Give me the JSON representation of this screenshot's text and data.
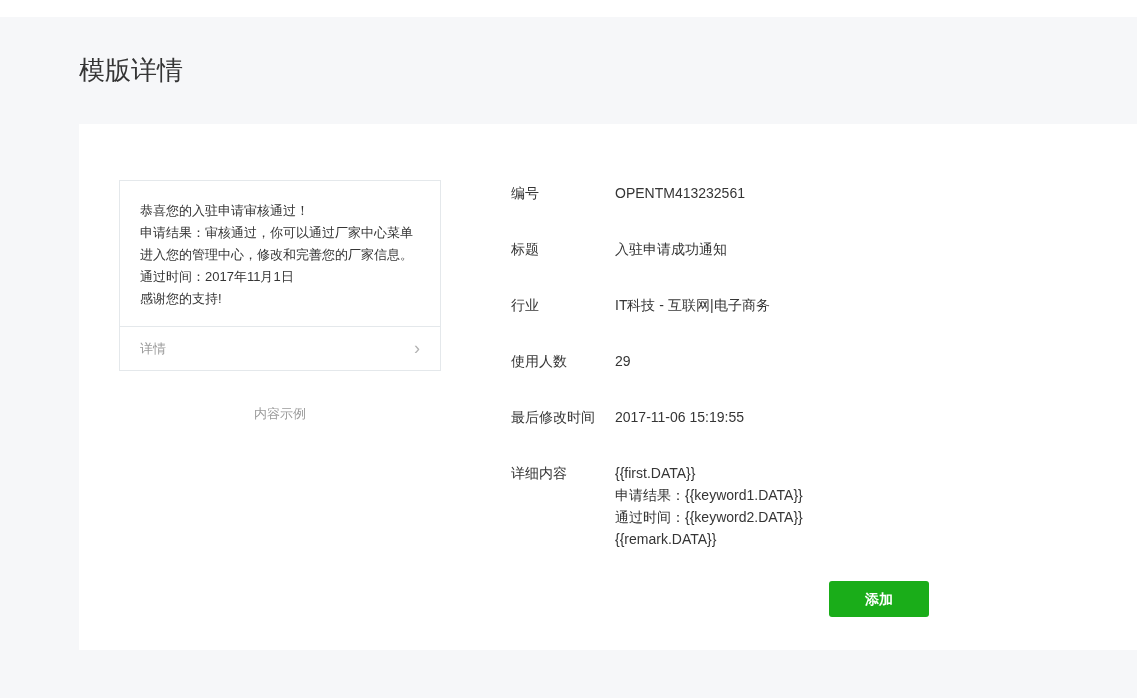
{
  "page_title": "模版详情",
  "preview": {
    "message_lines": [
      "恭喜您的入驻申请审核通过！",
      "申请结果：审核通过，你可以通过厂家中心菜单进入您的管理中心，修改和完善您的厂家信息。",
      "通过时间：2017年11月1日",
      "感谢您的支持!"
    ],
    "details_link": "详情",
    "arrow": "›",
    "caption": "内容示例"
  },
  "fields": [
    {
      "label": "编号",
      "value_lines": [
        "OPENTM413232561"
      ]
    },
    {
      "label": "标题",
      "value_lines": [
        "入驻申请成功通知"
      ]
    },
    {
      "label": "行业",
      "value_lines": [
        "IT科技 - 互联网|电子商务"
      ]
    },
    {
      "label": "使用人数",
      "value_lines": [
        "29"
      ]
    },
    {
      "label": "最后修改时间",
      "value_lines": [
        "2017-11-06 15:19:55"
      ]
    },
    {
      "label": "详细内容",
      "value_lines": [
        "{{first.DATA}}",
        "申请结果：{{keyword1.DATA}}",
        "通过时间：{{keyword2.DATA}}",
        "{{remark.DATA}}"
      ]
    }
  ],
  "add_button": "添加"
}
